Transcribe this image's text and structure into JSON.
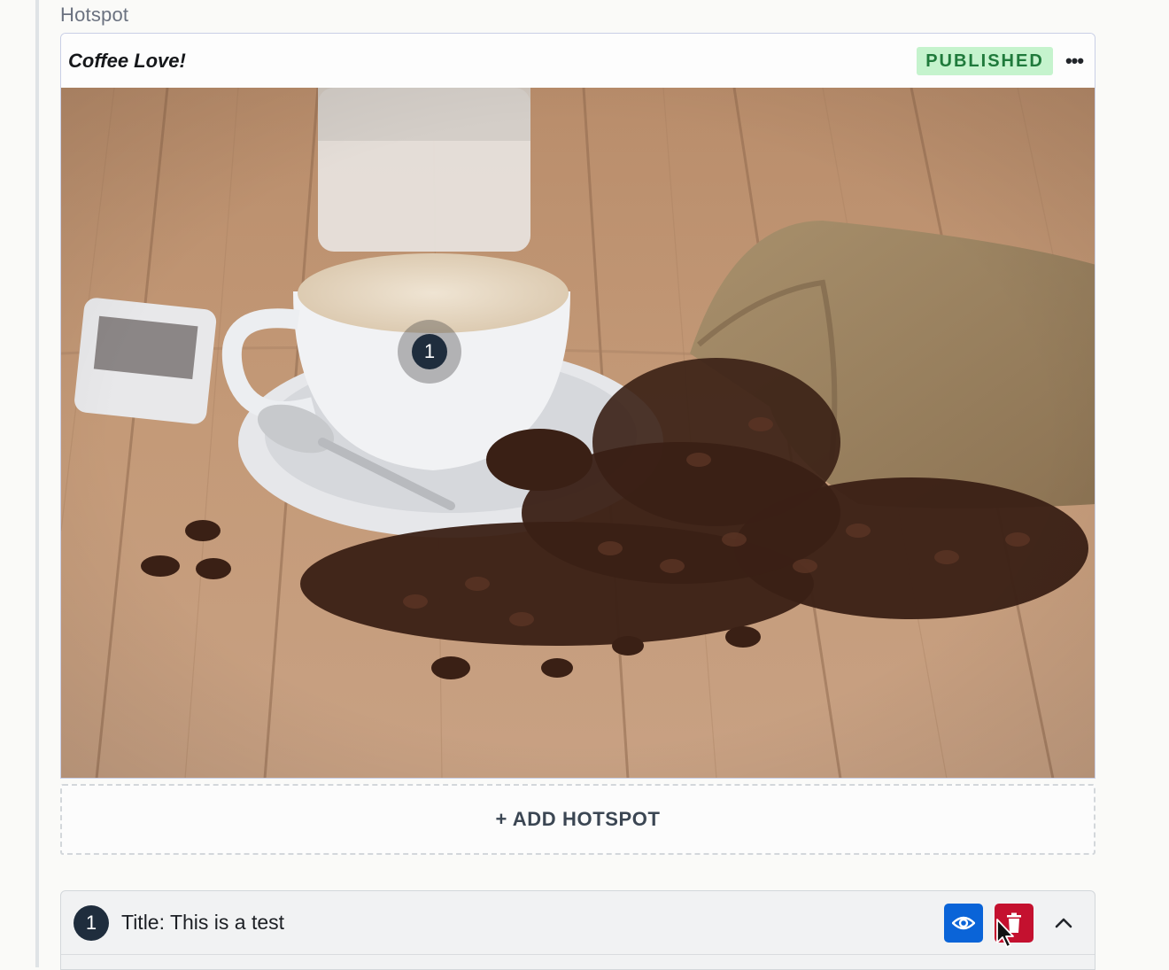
{
  "section": {
    "label": "Hotspot"
  },
  "card": {
    "title": "Coffee Love!",
    "status": "PUBLISHED",
    "more_icon": "ellipsis-icon",
    "more_label": "•••"
  },
  "image": {
    "subject": "cup of coffee with spilled coffee beans and burlap sack on wooden table",
    "hotspots": [
      {
        "number": "1"
      }
    ]
  },
  "add_hotspot": {
    "label": "+ ADD HOTSPOT"
  },
  "hotspot_list": [
    {
      "number": "1",
      "title": "Title: This is a test",
      "view_icon": "eye-icon",
      "delete_icon": "trash-icon",
      "collapse_icon": "chevron-up-icon"
    }
  ],
  "colors": {
    "published_bg": "#c5f3cd",
    "published_text": "#1f7a3b",
    "view_button": "#0a64d8",
    "delete_button": "#c4112f",
    "marker": "#1f2d3d"
  }
}
